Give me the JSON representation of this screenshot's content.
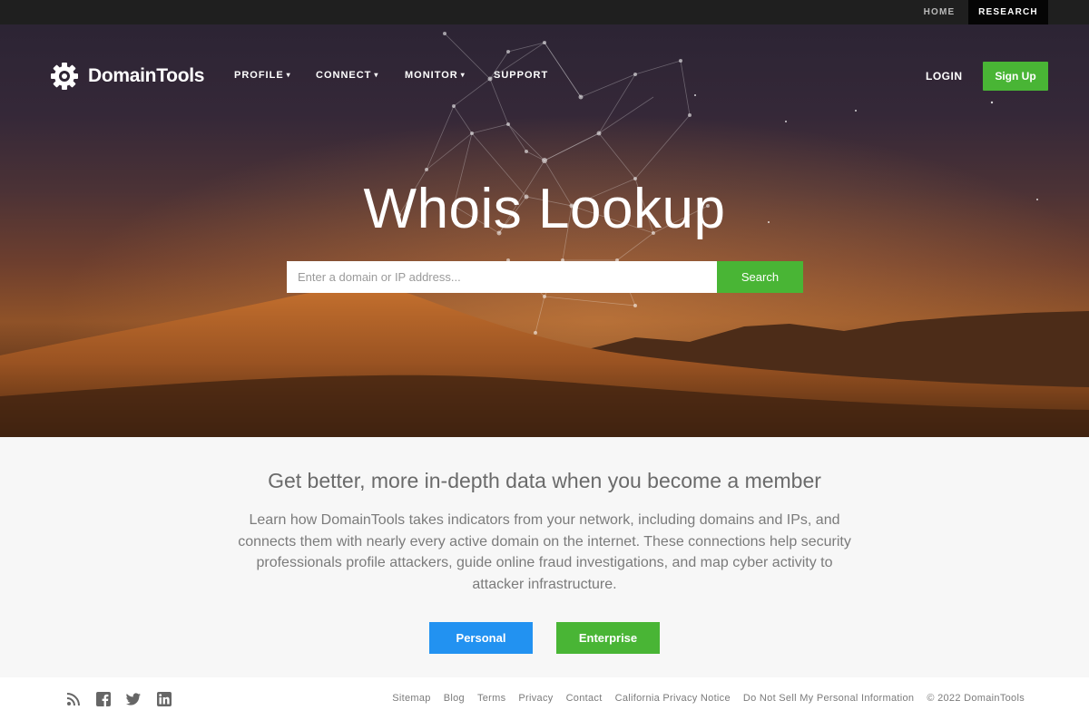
{
  "topbar": {
    "home": "HOME",
    "research": "RESEARCH"
  },
  "brand": {
    "name": "DomainTools"
  },
  "nav": {
    "profile": "PROFILE",
    "connect": "CONNECT",
    "monitor": "MONITOR",
    "support": "SUPPORT",
    "caret": "▾"
  },
  "header": {
    "login": "LOGIN",
    "signup": "Sign Up"
  },
  "hero": {
    "title": "Whois Lookup",
    "search_placeholder": "Enter a domain or IP address...",
    "search_button": "Search"
  },
  "member": {
    "heading": "Get better, more in-depth data when you become a member",
    "body": "Learn how DomainTools takes indicators from your network, including domains and IPs, and connects them with nearly every active domain on the internet. These connections help security professionals profile attackers, guide online fraud investigations, and map cyber activity to attacker infrastructure.",
    "personal": "Personal",
    "enterprise": "Enterprise"
  },
  "footer": {
    "icons": [
      "rss-icon",
      "facebook-icon",
      "twitter-icon",
      "linkedin-icon"
    ],
    "links": [
      "Sitemap",
      "Blog",
      "Terms",
      "Privacy",
      "Contact",
      "California Privacy Notice",
      "Do Not Sell My Personal Information"
    ],
    "copyright": "© 2022 DomainTools"
  },
  "colors": {
    "green": "#49b535",
    "blue": "#2292f1",
    "topbar": "#1f1f1f"
  }
}
